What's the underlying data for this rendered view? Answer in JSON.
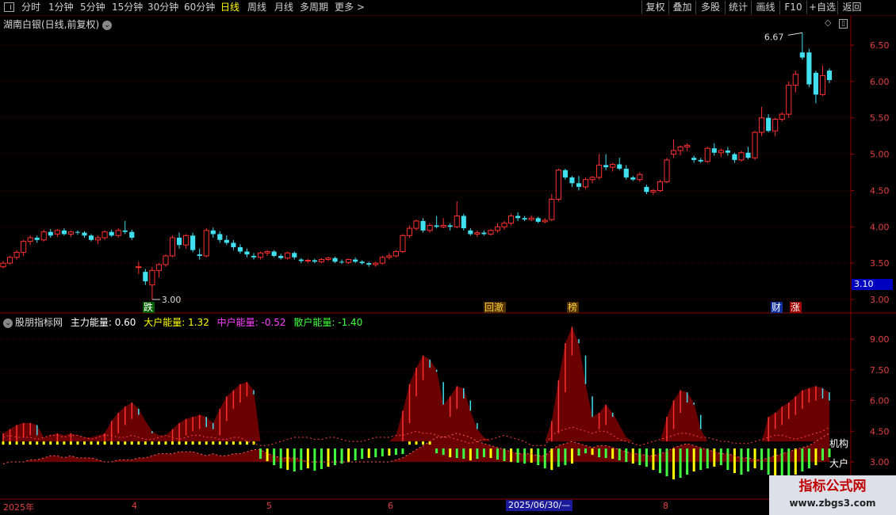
{
  "toolbar": {
    "left": [
      "分时",
      "1分钟",
      "5分钟",
      "15分钟",
      "30分钟",
      "60分钟",
      "日线",
      "周线",
      "月线",
      "多周期",
      "更多 >"
    ],
    "selected": "日线",
    "right": [
      "复权",
      "叠加",
      "多股",
      "统计",
      "画线",
      "F10",
      "+自选",
      "返回"
    ]
  },
  "stock": {
    "title": "湖南白银(日线,前复权)"
  },
  "price_axis": {
    "ticks": [
      "6.50",
      "6.00",
      "5.50",
      "5.00",
      "4.50",
      "4.00",
      "3.50",
      "3.00"
    ],
    "current": "3.10"
  },
  "annotations": {
    "high": "6.67",
    "low": "3.00"
  },
  "events": [
    {
      "label": "跌",
      "color": "#ffffff",
      "bg": "#006000"
    },
    {
      "label": "回澈",
      "color": "#ffd040",
      "bg": "#503000"
    },
    {
      "label": "榜",
      "color": "#ffd040",
      "bg": "#503000"
    },
    {
      "label": "财",
      "color": "#ffffff",
      "bg": "#1030a0"
    },
    {
      "label": "涨",
      "color": "#ffffff",
      "bg": "#a00000"
    }
  ],
  "indicator": {
    "name": "股朋指标网",
    "values": [
      {
        "label": "主力能量: 0.60",
        "color": "#ffffff"
      },
      {
        "label": "大户能量: 1.32",
        "color": "#ffff00"
      },
      {
        "label": "中户能量: -0.52",
        "color": "#ff40ff"
      },
      {
        "label": "散户能量: -1.40",
        "color": "#40ff40"
      }
    ],
    "axis": [
      "9.00",
      "7.50",
      "6.00",
      "4.50",
      "3.00"
    ],
    "line_labels": [
      "机构",
      "大户"
    ]
  },
  "dates": {
    "labels": [
      "2025年",
      "4",
      "5",
      "6",
      "8"
    ],
    "selected": "2025/06/30/—"
  },
  "watermark": {
    "title": "指标公式网",
    "url": "www.zbgs3.com"
  },
  "chart_data": {
    "type": "candlestick",
    "ylim": [
      2.85,
      6.75
    ],
    "candles": [
      [
        3.45,
        3.53,
        3.43,
        3.5
      ],
      [
        3.5,
        3.6,
        3.48,
        3.58
      ],
      [
        3.58,
        3.68,
        3.55,
        3.65
      ],
      [
        3.65,
        3.82,
        3.6,
        3.8
      ],
      [
        3.8,
        3.88,
        3.75,
        3.85
      ],
      [
        3.85,
        3.88,
        3.78,
        3.82
      ],
      [
        3.82,
        3.96,
        3.8,
        3.93
      ],
      [
        3.93,
        3.97,
        3.85,
        3.88
      ],
      [
        3.9,
        3.97,
        3.86,
        3.95
      ],
      [
        3.95,
        3.98,
        3.88,
        3.9
      ],
      [
        3.9,
        3.95,
        3.86,
        3.93
      ],
      [
        3.93,
        3.95,
        3.89,
        3.92
      ],
      [
        3.92,
        3.94,
        3.85,
        3.88
      ],
      [
        3.88,
        3.9,
        3.8,
        3.82
      ],
      [
        3.82,
        3.88,
        3.76,
        3.85
      ],
      [
        3.85,
        3.95,
        3.82,
        3.93
      ],
      [
        3.93,
        3.96,
        3.86,
        3.88
      ],
      [
        3.88,
        3.98,
        3.85,
        3.95
      ],
      [
        3.95,
        4.08,
        3.9,
        3.93
      ],
      [
        3.93,
        3.96,
        3.82,
        3.85
      ],
      [
        3.45,
        3.52,
        3.35,
        3.45
      ],
      [
        3.38,
        3.42,
        3.2,
        3.25
      ],
      [
        3.2,
        3.45,
        3.0,
        3.4
      ],
      [
        3.4,
        3.5,
        3.3,
        3.48
      ],
      [
        3.48,
        3.62,
        3.45,
        3.6
      ],
      [
        3.6,
        3.88,
        3.58,
        3.85
      ],
      [
        3.85,
        3.92,
        3.7,
        3.75
      ],
      [
        3.75,
        3.9,
        3.7,
        3.88
      ],
      [
        3.88,
        3.92,
        3.65,
        3.68
      ],
      [
        3.62,
        3.7,
        3.55,
        3.6
      ],
      [
        3.6,
        3.98,
        3.58,
        3.95
      ],
      [
        3.95,
        3.99,
        3.85,
        3.9
      ],
      [
        3.9,
        3.94,
        3.78,
        3.82
      ],
      [
        3.82,
        3.88,
        3.75,
        3.78
      ],
      [
        3.78,
        3.82,
        3.68,
        3.72
      ],
      [
        3.72,
        3.76,
        3.63,
        3.66
      ],
      [
        3.66,
        3.7,
        3.58,
        3.62
      ],
      [
        3.6,
        3.64,
        3.55,
        3.58
      ],
      [
        3.58,
        3.66,
        3.55,
        3.64
      ],
      [
        3.64,
        3.68,
        3.6,
        3.66
      ],
      [
        3.66,
        3.68,
        3.58,
        3.6
      ],
      [
        3.6,
        3.63,
        3.55,
        3.57
      ],
      [
        3.57,
        3.66,
        3.55,
        3.64
      ],
      [
        3.64,
        3.66,
        3.55,
        3.58
      ],
      [
        3.55,
        3.57,
        3.5,
        3.53
      ],
      [
        3.53,
        3.56,
        3.5,
        3.54
      ],
      [
        3.54,
        3.56,
        3.5,
        3.52
      ],
      [
        3.52,
        3.57,
        3.5,
        3.55
      ],
      [
        3.55,
        3.59,
        3.53,
        3.57
      ],
      [
        3.57,
        3.59,
        3.5,
        3.52
      ],
      [
        3.52,
        3.55,
        3.49,
        3.51
      ],
      [
        3.51,
        3.56,
        3.49,
        3.55
      ],
      [
        3.55,
        3.58,
        3.5,
        3.52
      ],
      [
        3.52,
        3.54,
        3.48,
        3.5
      ],
      [
        3.5,
        3.52,
        3.45,
        3.48
      ],
      [
        3.48,
        3.52,
        3.45,
        3.5
      ],
      [
        3.5,
        3.6,
        3.48,
        3.58
      ],
      [
        3.58,
        3.64,
        3.55,
        3.6
      ],
      [
        3.6,
        3.68,
        3.58,
        3.66
      ],
      [
        3.66,
        3.9,
        3.64,
        3.88
      ],
      [
        3.88,
        4.02,
        3.85,
        3.98
      ],
      [
        3.98,
        4.1,
        3.95,
        4.08
      ],
      [
        4.08,
        4.12,
        3.92,
        3.95
      ],
      [
        3.95,
        4.05,
        3.92,
        4.02
      ],
      [
        4.02,
        4.15,
        3.98,
        4.0
      ],
      [
        4.0,
        4.12,
        3.98,
        4.02
      ],
      [
        4.02,
        4.05,
        3.95,
        4.0
      ],
      [
        4.0,
        4.35,
        3.98,
        4.15
      ],
      [
        4.15,
        4.18,
        3.95,
        3.98
      ],
      [
        3.95,
        3.98,
        3.88,
        3.9
      ],
      [
        3.9,
        3.95,
        3.86,
        3.92
      ],
      [
        3.92,
        3.95,
        3.88,
        3.9
      ],
      [
        3.9,
        3.97,
        3.88,
        3.95
      ],
      [
        3.95,
        4.05,
        3.92,
        4.0
      ],
      [
        4.0,
        4.08,
        3.96,
        4.05
      ],
      [
        4.05,
        4.18,
        4.02,
        4.15
      ],
      [
        4.15,
        4.2,
        4.08,
        4.12
      ],
      [
        4.12,
        4.15,
        4.08,
        4.1
      ],
      [
        4.1,
        4.16,
        4.08,
        4.12
      ],
      [
        4.12,
        4.14,
        4.05,
        4.07
      ],
      [
        4.07,
        4.12,
        4.05,
        4.09
      ],
      [
        4.1,
        4.45,
        4.08,
        4.38
      ],
      [
        4.38,
        4.8,
        4.35,
        4.78
      ],
      [
        4.78,
        4.8,
        4.65,
        4.68
      ],
      [
        4.68,
        4.7,
        4.55,
        4.6
      ],
      [
        4.6,
        4.7,
        4.5,
        4.55
      ],
      [
        4.55,
        4.68,
        4.52,
        4.65
      ],
      [
        4.65,
        4.7,
        4.6,
        4.68
      ],
      [
        4.68,
        5.0,
        4.65,
        4.85
      ],
      [
        4.85,
        5.0,
        4.78,
        4.82
      ],
      [
        4.82,
        4.88,
        4.76,
        4.86
      ],
      [
        4.86,
        4.95,
        4.78,
        4.8
      ],
      [
        4.8,
        4.85,
        4.65,
        4.68
      ],
      [
        4.68,
        4.7,
        4.63,
        4.65
      ],
      [
        4.65,
        4.75,
        4.62,
        4.72
      ],
      [
        4.55,
        4.58,
        4.45,
        4.48
      ],
      [
        4.48,
        4.52,
        4.44,
        4.5
      ],
      [
        4.5,
        4.65,
        4.48,
        4.62
      ],
      [
        4.62,
        4.95,
        4.6,
        4.92
      ],
      [
        5.0,
        5.2,
        4.95,
        5.05
      ],
      [
        5.05,
        5.12,
        4.98,
        5.1
      ],
      [
        5.1,
        5.15,
        5.04,
        5.12
      ],
      [
        4.95,
        4.98,
        4.88,
        4.92
      ],
      [
        4.92,
        4.95,
        4.88,
        4.9
      ],
      [
        4.9,
        5.1,
        4.88,
        5.08
      ],
      [
        5.08,
        5.15,
        4.98,
        5.02
      ],
      [
        5.02,
        5.08,
        4.96,
        5.05
      ],
      [
        5.05,
        5.1,
        4.98,
        5.02
      ],
      [
        5.0,
        5.02,
        4.88,
        4.92
      ],
      [
        4.92,
        5.05,
        4.9,
        5.02
      ],
      [
        5.02,
        5.1,
        4.93,
        4.95
      ],
      [
        4.95,
        5.32,
        4.92,
        5.3
      ],
      [
        5.3,
        5.65,
        5.25,
        5.5
      ],
      [
        5.5,
        5.55,
        5.3,
        5.32
      ],
      [
        5.32,
        5.5,
        5.25,
        5.48
      ],
      [
        5.48,
        5.58,
        5.45,
        5.55
      ],
      [
        5.55,
        6.0,
        5.5,
        5.95
      ],
      [
        5.95,
        6.15,
        5.85,
        6.1
      ],
      [
        6.4,
        6.67,
        6.3,
        6.33
      ],
      [
        6.4,
        6.45,
        5.92,
        5.96
      ],
      [
        6.12,
        6.15,
        5.7,
        5.82
      ],
      [
        5.82,
        6.22,
        5.8,
        6.08
      ],
      [
        6.15,
        6.18,
        5.98,
        6.02
      ]
    ],
    "indicator": {
      "bar_range": [
        -1.5,
        10.0
      ],
      "brown_top": [
        4.4,
        4.6,
        4.8,
        4.9,
        4.9,
        4.8,
        4.2,
        4.3,
        4.4,
        4.3,
        4.4,
        4.3,
        4.2,
        4.2,
        4.3,
        4.4,
        5.0,
        5.4,
        5.7,
        5.9,
        5.6,
        5.0,
        4.5,
        4.3,
        4.3,
        4.6,
        4.9,
        5.1,
        5.2,
        5.3,
        5.2,
        4.9,
        5.6,
        6.2,
        6.5,
        6.8,
        6.9,
        6.5,
        4.0,
        3.5,
        3.3,
        3.2,
        3.1,
        3.1,
        3.2,
        3.3,
        3.3,
        3.2,
        3.2,
        3.3,
        3.4,
        3.4,
        3.3,
        3.3,
        3.4,
        3.5,
        3.7,
        3.8,
        4.3,
        5.5,
        6.8,
        7.6,
        8.2,
        8.0,
        7.5,
        5.8,
        6.2,
        6.7,
        6.6,
        5.5,
        4.6,
        4.2,
        4.0,
        3.8,
        3.7,
        3.6,
        3.5,
        3.4,
        3.4,
        3.4,
        3.4,
        5.0,
        7.0,
        8.8,
        9.6,
        8.8,
        6.8,
        5.2,
        5.4,
        5.8,
        5.4,
        4.8,
        4.2,
        4.0,
        4.0,
        3.8,
        3.7,
        4.0,
        5.2,
        6.0,
        6.5,
        6.4,
        5.9,
        4.6,
        4.0,
        3.8,
        3.7,
        3.6,
        3.5,
        3.4,
        3.3,
        3.3,
        3.2,
        5.2,
        5.4,
        5.7,
        5.9,
        6.2,
        6.5,
        6.6,
        6.7,
        6.6,
        6.4
      ],
      "bars": [
        0.4,
        0.3,
        0.2,
        0.1,
        0.1,
        0.2,
        0.4,
        0.3,
        0.2,
        0.2,
        0.3,
        0.2,
        0.2,
        0.3,
        0.2,
        0.1,
        0.1,
        0.2,
        0.3,
        0.2,
        0.1,
        0.1,
        0.2,
        0.3,
        0.3,
        0.2,
        0.1,
        0.1,
        0.2,
        0.3,
        0.3,
        0.2,
        0.1,
        0.2,
        0.3,
        0.3,
        0.2,
        0.1,
        -1.0,
        -1.3,
        -1.8,
        -2.2,
        -2.4,
        -2.6,
        -2.4,
        -2.2,
        -2.5,
        -2.3,
        -2.0,
        -1.8,
        -1.6,
        -1.4,
        -1.2,
        -1.0,
        -0.9,
        -0.8,
        -0.7,
        -0.6,
        -0.5,
        -0.4,
        0.2,
        0.4,
        0.3,
        0.2,
        -0.3,
        -0.5,
        -0.8,
        -0.9,
        -1.0,
        -1.2,
        -1.0,
        -0.8,
        -0.9,
        -1.1,
        -1.3,
        -1.4,
        -1.5,
        -1.6,
        -1.5,
        -1.8,
        -2.2,
        -2.4,
        -2.0,
        -1.8,
        -1.6,
        -0.6,
        -0.3,
        -0.5,
        -0.8,
        -0.9,
        -1.0,
        -1.2,
        -1.4,
        -1.6,
        -1.8,
        -2.0,
        -2.4,
        -2.8,
        -3.2,
        -3.6,
        -3.4,
        -3.0,
        -2.6,
        -2.4,
        -2.2,
        -2.0,
        -1.8,
        -2.4,
        -2.8,
        -3.0,
        -2.6,
        -2.2,
        -2.4,
        -3.0,
        -3.6,
        -3.8,
        -3.4,
        -3.0,
        -2.6,
        -2.2,
        -1.8,
        -1.2,
        -0.8
      ],
      "line_inst": [
        4.2,
        4.3,
        4.2,
        4.2,
        4.2,
        4.1,
        4.2,
        4.3,
        4.3,
        4.2,
        4.3,
        4.3,
        4.2,
        4.1,
        4.2,
        4.3,
        4.3,
        4.2,
        4.2,
        4.3,
        4.2,
        4.1,
        4.1,
        4.2,
        4.3,
        4.2,
        4.1,
        4.2,
        4.3,
        4.3,
        4.2,
        4.2,
        4.1,
        4.1,
        4.2,
        4.2,
        4.0,
        3.9,
        3.8,
        3.8,
        3.9,
        4.0,
        4.1,
        4.2,
        4.2,
        4.2,
        4.1,
        4.1,
        4.2,
        4.2,
        4.1,
        4.0,
        4.0,
        4.0,
        4.1,
        4.2,
        4.2,
        4.2,
        4.3,
        4.3,
        4.4,
        4.5,
        4.4,
        4.4,
        4.3,
        4.2,
        4.2,
        4.1,
        4.0,
        3.9,
        4.0,
        4.1,
        4.1,
        4.2,
        4.3,
        4.2,
        4.1,
        4.0,
        3.8,
        3.8,
        3.8,
        4.3,
        4.5,
        4.6,
        4.7,
        4.6,
        4.5,
        4.4,
        4.5,
        4.5,
        4.3,
        4.1,
        4.0,
        3.9,
        3.8,
        3.9,
        4.0,
        4.1,
        4.2,
        4.3,
        4.4,
        4.4,
        4.3,
        4.2,
        4.2,
        4.1,
        4.0,
        4.0,
        3.9,
        3.9,
        3.9,
        4.0,
        4.1,
        4.2,
        4.3,
        4.3,
        4.2,
        4.1,
        4.2,
        4.3,
        4.4,
        4.5,
        4.7
      ],
      "line_big": [
        2.9,
        3.0,
        3.0,
        3.0,
        3.1,
        3.1,
        3.2,
        3.3,
        3.3,
        3.2,
        3.3,
        3.2,
        3.2,
        3.2,
        3.1,
        3.0,
        3.0,
        3.1,
        3.1,
        3.1,
        3.2,
        3.2,
        3.3,
        3.4,
        3.4,
        3.4,
        3.5,
        3.5,
        3.5,
        3.4,
        3.3,
        3.4,
        3.3,
        3.3,
        3.4,
        3.4,
        3.5,
        3.6,
        3.6,
        3.4,
        3.3,
        3.2,
        3.2,
        3.2,
        3.1,
        3.0,
        3.0,
        3.0,
        3.0,
        3.0,
        3.0,
        3.0,
        3.0,
        3.0,
        3.0,
        3.0,
        3.0,
        3.0,
        3.1,
        3.2,
        3.4,
        3.6,
        3.8,
        4.0,
        4.2,
        4.2,
        4.3,
        4.4,
        4.3,
        4.2,
        4.0,
        3.9,
        3.8,
        3.7,
        3.6,
        3.5,
        3.4,
        3.4,
        3.4,
        3.3,
        3.3,
        3.6,
        3.8,
        3.9,
        4.0,
        3.9,
        3.8,
        3.7,
        3.8,
        3.8,
        3.7,
        3.6,
        3.5,
        3.4,
        3.4,
        3.3,
        3.3,
        3.4,
        3.5,
        3.7,
        3.8,
        3.9,
        3.8,
        3.7,
        3.6,
        3.5,
        3.4,
        3.4,
        3.3,
        3.2,
        3.2,
        3.1,
        3.1,
        3.2,
        3.3,
        3.4,
        3.5,
        3.6,
        3.7,
        3.8,
        4.0,
        4.2,
        4.4
      ]
    }
  }
}
